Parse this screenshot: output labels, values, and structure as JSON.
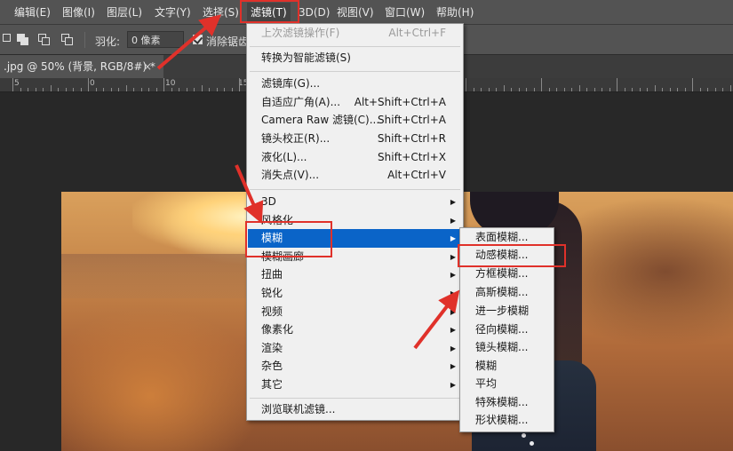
{
  "menubar": {
    "items": [
      {
        "label": "编辑(E)"
      },
      {
        "label": "图像(I)"
      },
      {
        "label": "图层(L)"
      },
      {
        "label": "文字(Y)"
      },
      {
        "label": "选择(S)"
      },
      {
        "label": "滤镜(T)"
      },
      {
        "label": "3D(D)"
      },
      {
        "label": "视图(V)"
      },
      {
        "label": "窗口(W)"
      },
      {
        "label": "帮助(H)"
      }
    ]
  },
  "options_bar": {
    "feather_label": "羽化:",
    "feather_value": "0 像素",
    "antialias_label": "消除锯齿",
    "antialias_checked": true
  },
  "document_tab": {
    "title": ".jpg @ 50% (背景, RGB/8#) *",
    "close": "×"
  },
  "ruler": {
    "labels": [
      "5",
      "0",
      "5",
      "10",
      "15"
    ]
  },
  "filter_menu": {
    "items": [
      {
        "label": "上次滤镜操作(F)",
        "shortcut": "Alt+Ctrl+F",
        "disabled": true
      },
      {
        "label": "转换为智能滤镜(S)",
        "shortcut": ""
      },
      {
        "label": "滤镜库(G)...",
        "shortcut": ""
      },
      {
        "label": "自适应广角(A)...",
        "shortcut": "Alt+Shift+Ctrl+A"
      },
      {
        "label": "Camera Raw 滤镜(C)...",
        "shortcut": "Shift+Ctrl+A"
      },
      {
        "label": "镜头校正(R)...",
        "shortcut": "Shift+Ctrl+R"
      },
      {
        "label": "液化(L)...",
        "shortcut": "Shift+Ctrl+X"
      },
      {
        "label": "消失点(V)...",
        "shortcut": "Alt+Ctrl+V"
      },
      {
        "label": "3D",
        "submenu": true
      },
      {
        "label": "风格化",
        "submenu": true
      },
      {
        "label": "模糊",
        "submenu": true,
        "highlighted": true
      },
      {
        "label": "模糊画廊",
        "submenu": true
      },
      {
        "label": "扭曲",
        "submenu": true
      },
      {
        "label": "锐化",
        "submenu": true
      },
      {
        "label": "视频",
        "submenu": true
      },
      {
        "label": "像素化",
        "submenu": true
      },
      {
        "label": "渲染",
        "submenu": true
      },
      {
        "label": "杂色",
        "submenu": true
      },
      {
        "label": "其它",
        "submenu": true
      },
      {
        "label": "浏览联机滤镜..."
      }
    ]
  },
  "blur_submenu": {
    "items": [
      {
        "label": "表面模糊..."
      },
      {
        "label": "动感模糊..."
      },
      {
        "label": "方框模糊..."
      },
      {
        "label": "高斯模糊..."
      },
      {
        "label": "进一步模糊"
      },
      {
        "label": "径向模糊..."
      },
      {
        "label": "镜头模糊..."
      },
      {
        "label": "模糊"
      },
      {
        "label": "平均"
      },
      {
        "label": "特殊模糊..."
      },
      {
        "label": "形状模糊..."
      }
    ]
  },
  "colors": {
    "highlight": "#0a64c8",
    "annotation_red": "#e0312a",
    "ui_dark": "#535353"
  }
}
